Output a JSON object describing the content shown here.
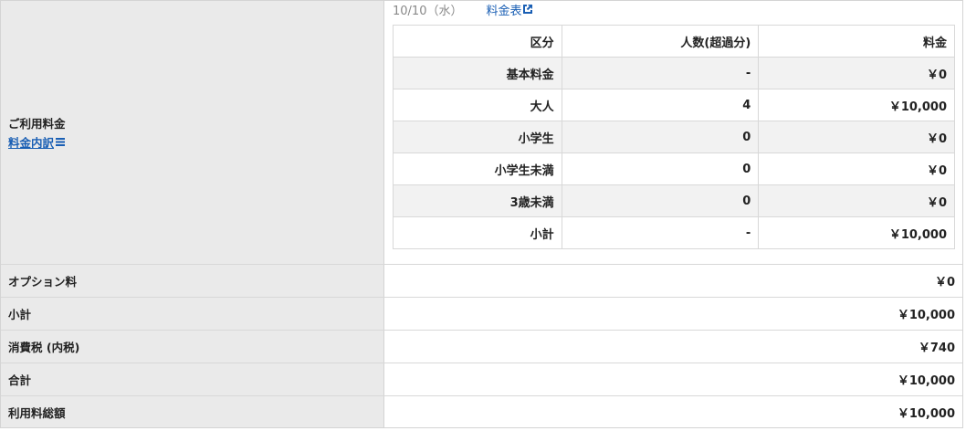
{
  "fee_section": {
    "label": "ご利用料金",
    "breakdown_link": "料金内訳",
    "date": "10/10（水）",
    "fee_table_link": "料金表",
    "table": {
      "headers": [
        "区分",
        "人数(超過分)",
        "料金"
      ],
      "rows": [
        {
          "category": "基本料金",
          "count": "-",
          "price": "￥0"
        },
        {
          "category": "大人",
          "count": "4",
          "price": "￥10,000"
        },
        {
          "category": "小学生",
          "count": "0",
          "price": "￥0"
        },
        {
          "category": "小学生未満",
          "count": "0",
          "price": "￥0"
        },
        {
          "category": "3歳未満",
          "count": "0",
          "price": "￥0"
        },
        {
          "category": "小計",
          "count": "-",
          "price": "￥10,000"
        }
      ]
    }
  },
  "summary_rows": [
    {
      "label": "オプション料",
      "value": "￥0"
    },
    {
      "label": "小計",
      "value": "￥10,000"
    },
    {
      "label": "消費税 (内税)",
      "value": "￥740"
    },
    {
      "label": "合計",
      "value": "￥10,000"
    },
    {
      "label": "利用料総額",
      "value": "￥10,000"
    }
  ],
  "colors": {
    "label_bg": "#eaeaea",
    "link": "#1a5fb4",
    "border": "#d8d8d8"
  }
}
